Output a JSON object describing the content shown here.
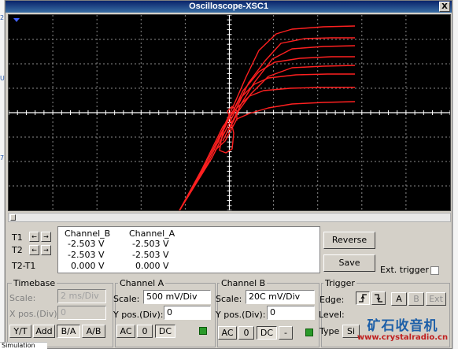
{
  "window": {
    "title": "Oscilloscope-XSC1",
    "close_label": "X"
  },
  "background": {
    "marks": [
      "2",
      "U",
      "7"
    ],
    "bottom_tab": "Simulation"
  },
  "screen": {
    "grid": {
      "h_divisions": 10,
      "v_divisions": 8
    },
    "trace_color": "#ff2020",
    "traces": [
      [
        [
          216,
          250
        ],
        [
          246,
          195
        ],
        [
          272,
          142
        ],
        [
          290,
          118
        ],
        [
          306,
          103
        ],
        [
          324,
          96
        ],
        [
          358,
          93
        ],
        [
          395,
          92
        ],
        [
          440,
          92
        ]
      ],
      [
        [
          216,
          250
        ],
        [
          250,
          190
        ],
        [
          276,
          138
        ],
        [
          294,
          106
        ],
        [
          312,
          88
        ],
        [
          330,
          80
        ],
        [
          365,
          76
        ],
        [
          405,
          75
        ],
        [
          440,
          75
        ]
      ],
      [
        [
          216,
          250
        ],
        [
          254,
          186
        ],
        [
          280,
          132
        ],
        [
          298,
          96
        ],
        [
          318,
          72
        ],
        [
          338,
          60
        ],
        [
          370,
          55
        ],
        [
          410,
          53
        ],
        [
          440,
          53
        ]
      ],
      [
        [
          216,
          250
        ],
        [
          258,
          182
        ],
        [
          286,
          126
        ],
        [
          305,
          86
        ],
        [
          326,
          58
        ],
        [
          346,
          36
        ],
        [
          376,
          30
        ],
        [
          410,
          29
        ],
        [
          440,
          29
        ]
      ],
      [
        [
          440,
          14
        ],
        [
          400,
          15
        ],
        [
          360,
          18
        ],
        [
          340,
          24
        ],
        [
          318,
          45
        ],
        [
          302,
          78
        ],
        [
          288,
          110
        ],
        [
          276,
          136
        ],
        [
          266,
          162
        ]
      ],
      [
        [
          440,
          39
        ],
        [
          400,
          40
        ],
        [
          360,
          43
        ],
        [
          335,
          56
        ],
        [
          312,
          86
        ],
        [
          296,
          112
        ],
        [
          282,
          140
        ],
        [
          272,
          160
        ]
      ],
      [
        [
          440,
          64
        ],
        [
          400,
          65
        ],
        [
          360,
          67
        ],
        [
          330,
          78
        ],
        [
          308,
          100
        ],
        [
          292,
          122
        ],
        [
          280,
          146
        ]
      ],
      [
        [
          440,
          110
        ],
        [
          400,
          111
        ],
        [
          360,
          113
        ],
        [
          330,
          118
        ],
        [
          306,
          125
        ],
        [
          290,
          132
        ],
        [
          275,
          160
        ],
        [
          262,
          172
        ]
      ],
      [
        [
          274,
          142
        ],
        [
          270,
          160
        ],
        [
          268,
          172
        ],
        [
          276,
          175
        ],
        [
          284,
          170
        ],
        [
          286,
          150
        ],
        [
          282,
          132
        ],
        [
          278,
          122
        ],
        [
          284,
          116
        ],
        [
          290,
          122
        ],
        [
          290,
          134
        ]
      ]
    ]
  },
  "cursors": {
    "t1": "T1",
    "t2": "T2",
    "t2t1": "T2-T1",
    "left_arrow": "←",
    "right_arrow": "→"
  },
  "readout": {
    "headers": [
      "Channel_B",
      "Channel_A"
    ],
    "rows": [
      [
        "-2.503 V",
        "-2.503 V"
      ],
      [
        "-2.503 V",
        "-2.503 V"
      ],
      [
        "0.000 V",
        "0.000 V"
      ]
    ]
  },
  "buttons": {
    "reverse": "Reverse",
    "save": "Save",
    "ext_trigger": "Ext. trigger"
  },
  "timebase": {
    "title": "Timebase",
    "scale_label": "Scale:",
    "scale_value": "2 ms/Div",
    "xpos_label": "X pos.(Div):",
    "xpos_value": "0",
    "modes": [
      "Y/T",
      "Add",
      "B/A",
      "A/B"
    ],
    "active_mode": "B/A"
  },
  "channel_a": {
    "title": "Channel A",
    "scale_label": "Scale:",
    "scale_value": "500 mV/Div",
    "ypos_label": "Y pos.(Div):",
    "ypos_value": "0",
    "coupling": [
      "AC",
      "0",
      "DC"
    ],
    "active_coupling": "DC"
  },
  "channel_b": {
    "title": "Channel B",
    "scale_label": "Scale:",
    "scale_value": "20C mV/Div",
    "ypos_label": "Y pos.(Div):",
    "ypos_value": "0",
    "coupling": [
      "AC",
      "0",
      "DC",
      "-"
    ],
    "active_coupling": "DC"
  },
  "trigger": {
    "title": "Trigger",
    "edge_label": "Edge:",
    "level_label": "Level:",
    "type_label": "Type",
    "sources": [
      "A",
      "B",
      "Ext"
    ],
    "type_value": "Si"
  },
  "watermark": {
    "text": "矿石收音机",
    "url": "www.crystalradio.cn"
  }
}
